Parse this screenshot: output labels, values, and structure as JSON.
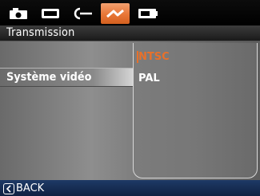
{
  "tabs": [
    {
      "icon": "camera-icon",
      "active": false
    },
    {
      "icon": "display-icon",
      "active": false
    },
    {
      "icon": "connector-icon",
      "active": false
    },
    {
      "icon": "transmission-icon",
      "active": true
    },
    {
      "icon": "battery-card-icon",
      "active": false
    }
  ],
  "header": {
    "title": "Transmission"
  },
  "menu": {
    "selected_item_label": "Système vidéo"
  },
  "options": [
    {
      "label": "NTSC",
      "selected": true
    },
    {
      "label": "PAL",
      "selected": false
    }
  ],
  "footer": {
    "back_label": "BACK"
  },
  "colors": {
    "accent": "#e8702a",
    "footer_bg": "#1e3a66"
  }
}
